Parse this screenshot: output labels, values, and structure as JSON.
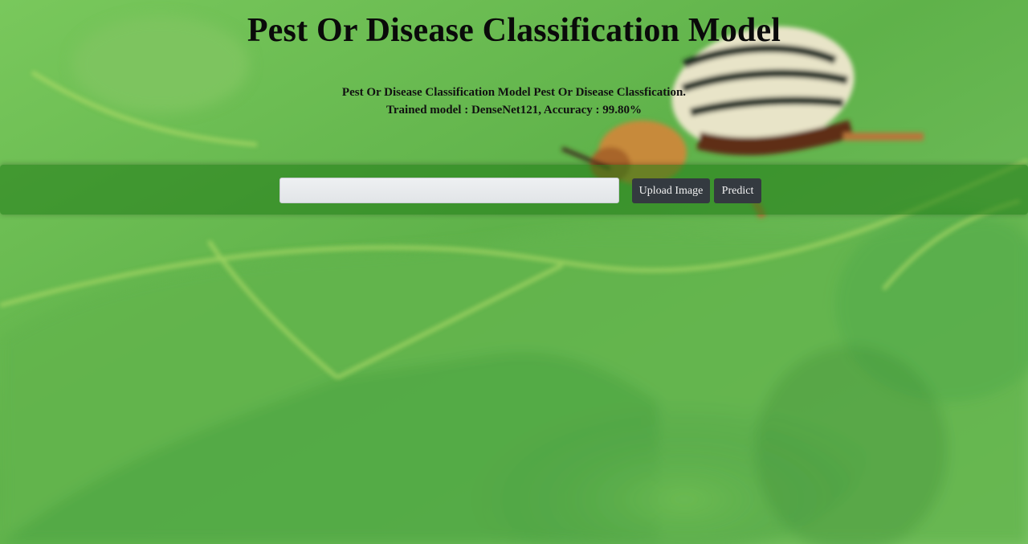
{
  "page": {
    "title": "Pest Or Disease Classification Model",
    "description_line1": "Pest Or Disease Classification Model Pest Or Disease Classfication.",
    "description_line2": "Trained model : DenseNet121, Accuracy : 99.80%"
  },
  "toolbar": {
    "file_input_value": "",
    "upload_label": "Upload Image",
    "predict_label": "Predict"
  },
  "background": {
    "image": "beetle-on-leaf",
    "colors": {
      "leaf_light": "#8fd36a",
      "leaf_dark": "#3f9a3a",
      "toolbar": "#1e7814"
    }
  }
}
